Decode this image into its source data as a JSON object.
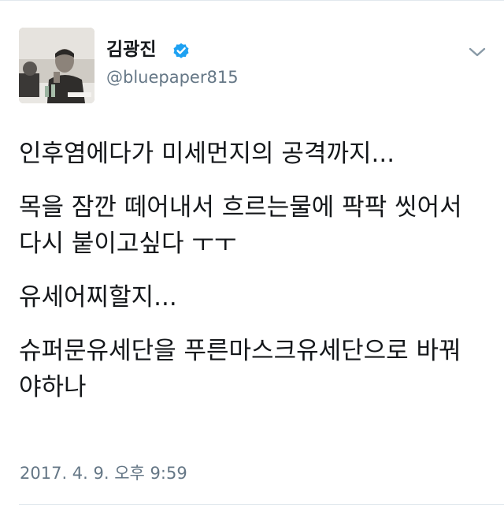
{
  "user": {
    "display_name": "김광진",
    "handle": "@bluepaper815",
    "verified": true,
    "verified_icon": "verified-badge-icon",
    "avatar": "profile-photo"
  },
  "menu": {
    "icon": "chevron-down-icon"
  },
  "tweet": {
    "paragraphs": [
      "인후염에다가 미세먼지의 공격까지...",
      "목을 잠깐 떼어내서 흐르는물에 팍팍 씻어서 다시 붙이고싶다 ㅜㅜ",
      "유세어찌할지...",
      "슈퍼문유세단을 푸른마스크유세단으로 바꿔야하나"
    ],
    "timestamp": "2017. 4. 9. 오후 9:59"
  },
  "colors": {
    "text": "#14171a",
    "secondary": "#657786",
    "verified": "#1da1f2",
    "divider": "#e1e8ed"
  }
}
